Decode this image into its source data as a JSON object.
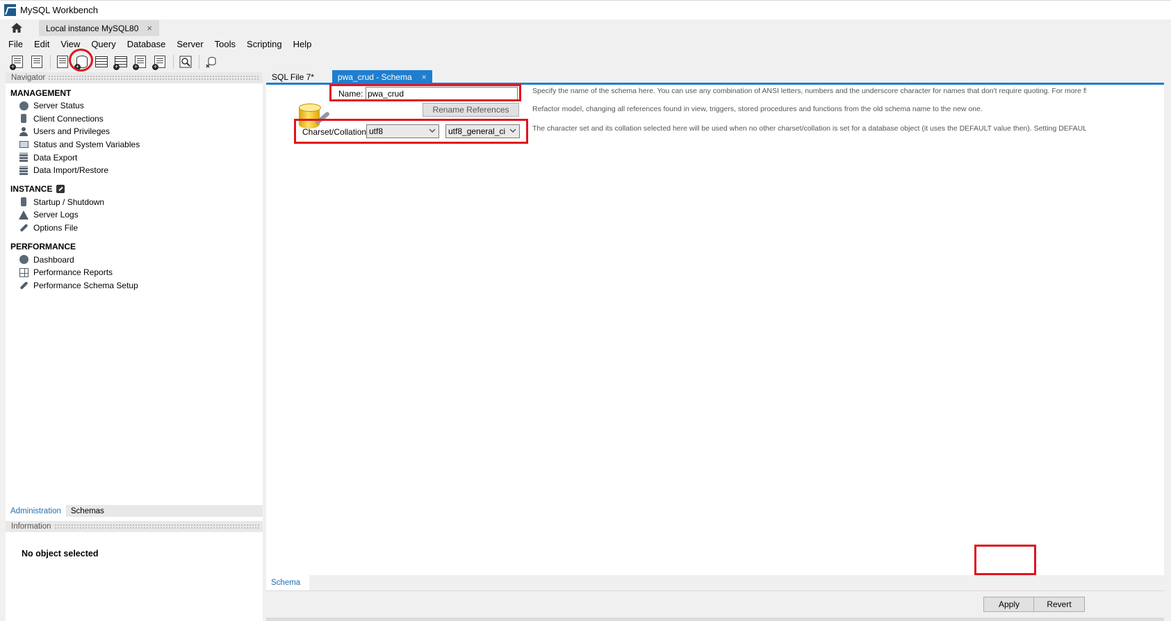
{
  "window": {
    "title": "MySQL Workbench"
  },
  "connection_tabs": [
    {
      "label": "Local instance MySQL80",
      "close": "×"
    }
  ],
  "menu": [
    "File",
    "Edit",
    "View",
    "Query",
    "Database",
    "Server",
    "Tools",
    "Scripting",
    "Help"
  ],
  "toolbar": {
    "buttons": [
      "new-sql-tab",
      "open-sql-script",
      "inspector",
      "create-schema",
      "create-table",
      "create-view",
      "create-stored-procedure",
      "create-function",
      "search-table-data",
      "reconnect"
    ]
  },
  "navigator": {
    "header": "Navigator",
    "sections": [
      {
        "title": "MANAGEMENT",
        "items": [
          "Server Status",
          "Client Connections",
          "Users and Privileges",
          "Status and System Variables",
          "Data Export",
          "Data Import/Restore"
        ]
      },
      {
        "title": "INSTANCE",
        "items": [
          "Startup / Shutdown",
          "Server Logs",
          "Options File"
        ]
      },
      {
        "title": "PERFORMANCE",
        "items": [
          "Dashboard",
          "Performance Reports",
          "Performance Schema Setup"
        ]
      }
    ],
    "tabs": [
      "Administration",
      "Schemas"
    ],
    "active_tab": "Administration"
  },
  "information": {
    "header": "Information",
    "message": "No object selected"
  },
  "editor_tabs": [
    {
      "label": "SQL File 7*"
    },
    {
      "label": "pwa_crud - Schema",
      "close": "×"
    }
  ],
  "schema_editor": {
    "name_label": "Name:",
    "name_value": "pwa_crud",
    "rename_button": "Rename References",
    "charset_label": "Charset/Collation:",
    "charset_value": "utf8",
    "collation_value": "utf8_general_ci",
    "help": {
      "name": "Specify the name of the schema here. You can use any combination of ANSI letters, numbers and the underscore character for names that don't require quoting. For more flexibility you can u",
      "rename": "Refactor model, changing all references found in view, triggers, stored procedures and functions from the old schema name to the new one.",
      "charset": "The character set and its collation selected here will be used when no other charset/collation is set for a database object (it uses the DEFAULT value then). Setting DEFAULT here will make the s"
    }
  },
  "editor_bottom_tabs": [
    "Schema"
  ],
  "actions": {
    "apply": "Apply",
    "revert": "Revert"
  },
  "colors": {
    "accent": "#1f7ed0",
    "highlight": "#e0141e"
  }
}
